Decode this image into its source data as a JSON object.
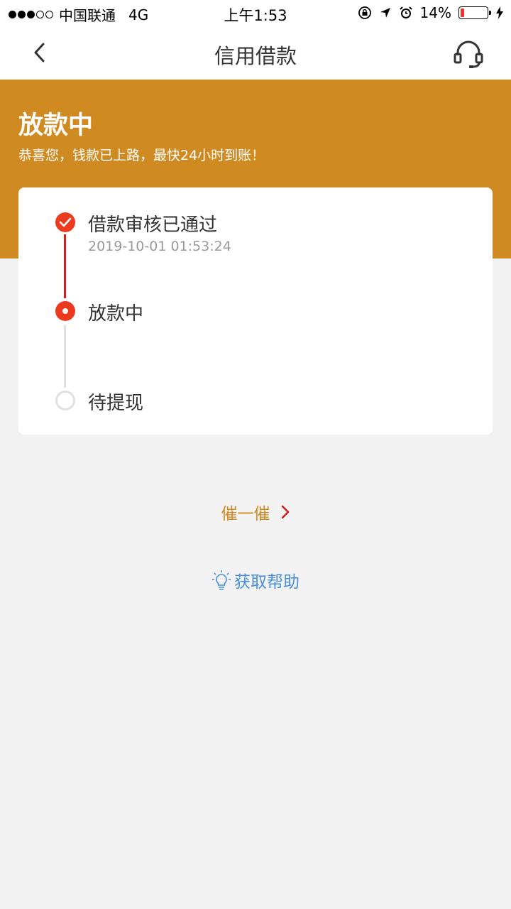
{
  "status_bar": {
    "carrier": "中国联通",
    "network": "4G",
    "time": "上午1:53",
    "battery_percent": "14%",
    "battery_level": 0.14
  },
  "nav": {
    "title": "信用借款"
  },
  "banner": {
    "title": "放款中",
    "description": "恭喜您，钱款已上路，最快24小时到账！"
  },
  "steps": [
    {
      "label": "借款审核已通过",
      "time": "2019-10-01 01:53:24",
      "state": "done"
    },
    {
      "label": "放款中",
      "state": "current"
    },
    {
      "label": "待提现",
      "state": "pending"
    }
  ],
  "actions": {
    "urge_label": "催一催",
    "help_label": "获取帮助"
  },
  "colors": {
    "banner": "#d08a22",
    "accent_red": "#ec3a1e",
    "help_blue": "#4a8fd8"
  }
}
